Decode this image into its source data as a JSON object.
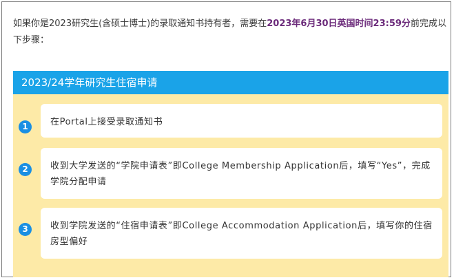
{
  "intro": {
    "text_before": "如果你是2023研究生(含硕士博士)的录取通知书持有者，需要在",
    "deadline": "2023年6月30日英国时间23:59分",
    "text_after": "前完成以下步骤："
  },
  "panel": {
    "title": "2023/24学年研究生住宿申请",
    "steps": [
      {
        "number": "1",
        "text": "在Portal上接受录取通知书"
      },
      {
        "number": "2",
        "text": "收到大学发送的“学院申请表”即College Membership Application后，填写“Yes”，完成学院分配申请"
      },
      {
        "number": "3",
        "text": "收到学院发送的“住宿申请表”即College Accommodation Application后，填写你的住宿房型偏好"
      }
    ]
  },
  "colors": {
    "header_bg": "#1aa3e8",
    "panel_bg": "#fdeaa7",
    "badge": "#1a8fe3",
    "deadline_text": "#6b2a7a"
  }
}
